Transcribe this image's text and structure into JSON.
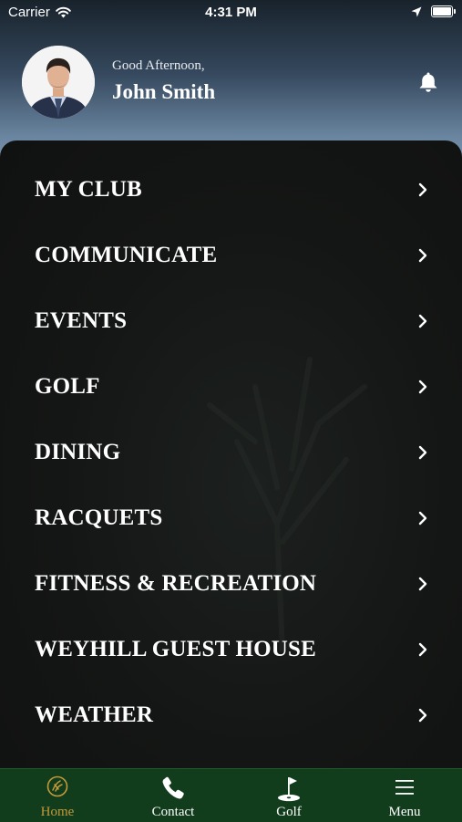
{
  "status_bar": {
    "carrier": "Carrier",
    "time": "4:31 PM"
  },
  "header": {
    "greeting": "Good Afternoon,",
    "user_name": "John Smith"
  },
  "menu": {
    "items": [
      {
        "label": "MY CLUB"
      },
      {
        "label": "COMMUNICATE"
      },
      {
        "label": "EVENTS"
      },
      {
        "label": "GOLF"
      },
      {
        "label": "DINING"
      },
      {
        "label": "RACQUETS"
      },
      {
        "label": "FITNESS & RECREATION"
      },
      {
        "label": "WEYHILL GUEST HOUSE"
      },
      {
        "label": "WEATHER"
      }
    ]
  },
  "tab_bar": {
    "active": "Home",
    "tabs": [
      {
        "label": "Home",
        "icon": "club-logo-icon"
      },
      {
        "label": "Contact",
        "icon": "phone-icon"
      },
      {
        "label": "Golf",
        "icon": "golf-flag-icon"
      },
      {
        "label": "Menu",
        "icon": "hamburger-icon"
      }
    ]
  },
  "colors": {
    "tab_bar_bg": "#113d1d",
    "active_tab": "#c49a3a",
    "menu_bg": "#141615"
  }
}
